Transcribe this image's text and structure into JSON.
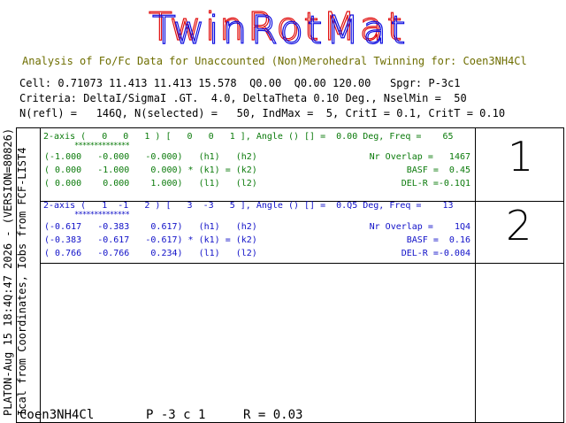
{
  "title": "TwinRotMat",
  "subtitle": "Analysis of Fo/Fc Data for Unaccounted (Non)Merohedral Twinning for: Coen3NH4Cl",
  "header": {
    "cell": "Cell: 0.71073 11.413 11.413 15.578  Q0.00  Q0.00 120.00   Spgr: P-3c1",
    "criteria": "Criteria: DeltaI/SigmaI .GT.  4.0, DeltaTheta 0.10 Deg., NselMin =  50",
    "nrefl": "N(refl) =   146Q, N(selected) =   50, IndMax =  5, CritI = 0.1, CritT = 0.10"
  },
  "side": {
    "upper": "PLATON-Aug 15 18:4Q:47 2026 - (VERSION=80826)",
    "lower": "Ical from Coordinates, Iobs from FCF-LIST4"
  },
  "solutions": [
    {
      "number": "1",
      "axis": "2-axis (   0   0   1 ) [   0   0   1 ], Angle () [] =  0.00 Deg, Freq =    65",
      "stars": "**************",
      "rows": [
        "(-1.000   -0.000   -0.000)   (h1)   (h2)",
        "( 0.000   -1.000    0.000) * (k1) = (k2)",
        "( 0.000    0.000    1.000)   (l1)   (l2)"
      ],
      "stats": [
        "Nr Overlap =   1467",
        "BASF =  0.45",
        "DEL-R =-0.1Q1"
      ]
    },
    {
      "number": "2",
      "axis": "2-axis (   1  -1   2 ) [   3  -3   5 ], Angle () [] =  0.Q5 Deg, Freq =    13",
      "stars": "**************",
      "rows": [
        "(-0.617   -0.383    0.617)   (h1)   (h2)",
        "(-0.383   -0.617   -0.617) * (k1) = (k2)",
        "( 0.766   -0.766    0.234)   (l1)   (l2)"
      ],
      "stats": [
        "Nr Overlap =    1Q4",
        "BASF =  0.16",
        "DEL-R =-0.004"
      ]
    }
  ],
  "footer": {
    "compound": "Coen3NH4Cl",
    "spacegroup": "P -3 c 1",
    "rvalue": "R = 0.03"
  },
  "colors": {
    "title_red": "#e01010",
    "title_blue": "#1010e0",
    "green": "#0a7a0a",
    "blue": "#1010c8",
    "olive": "#6e6e00"
  }
}
